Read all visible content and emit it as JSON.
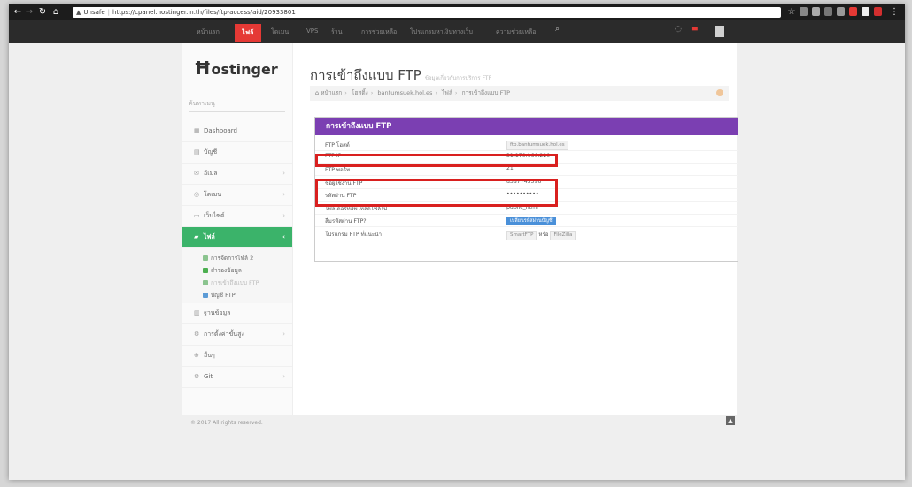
{
  "browser": {
    "url_label": "Unsafe",
    "url": "https://cpanel.hostinger.in.th/files/ftp-access/aid/20933801"
  },
  "topnav": {
    "items": [
      "หน้าแรก",
      "ไฟล์",
      "โดเมน",
      "VPS",
      "ร้าน",
      "การช่วยเหลือ",
      "โปรแกรมหาเงินทางเว็บ",
      "ความช่วยเหลือ"
    ],
    "active": "ไฟล์"
  },
  "sidebar": {
    "logo": "ostinger",
    "search_placeholder": "ค้นหาเมนู",
    "menu": [
      {
        "label": "Dashboard",
        "icon": "dashboard-icon"
      },
      {
        "label": "บัญชี",
        "icon": "user-icon"
      },
      {
        "label": "อีเมล",
        "icon": "mail-icon"
      },
      {
        "label": "โดเมน",
        "icon": "globe-icon"
      },
      {
        "label": "เว็บไซต์",
        "icon": "monitor-icon"
      }
    ],
    "active_item": "ไฟล์",
    "sub_items": [
      "การจัดการไฟล์ 2",
      "สำรองข้อมูล",
      "การเข้าถึงแบบ FTP",
      "บัญชี FTP"
    ],
    "after_items": [
      {
        "label": "ฐานข้อมูล",
        "icon": "database-icon"
      },
      {
        "label": "การตั้งค่าขั้นสูง",
        "icon": "gears-icon"
      },
      {
        "label": "อื่นๆ",
        "icon": "plus-icon"
      },
      {
        "label": "Git",
        "icon": "git-icon"
      }
    ]
  },
  "page": {
    "title": "การเข้าถึงแบบ FTP",
    "title_small": "ข้อมูลเกี่ยวกับการบริการ FTP",
    "breadcrumb": [
      "หน้าแรก",
      "โฮสติ้ง",
      "bantumsuek.hol.es",
      "ไฟล์",
      "การเข้าถึงแบบ FTP"
    ],
    "panel_title": "การเข้าถึงแบบ FTP",
    "rows": [
      {
        "label": "FTP โฮสต์",
        "value": "ftp.bantumsuek.hol.es"
      },
      {
        "label": "FTP IP",
        "value": "31.170.166.220"
      },
      {
        "label": "FTP พอร์ท",
        "value": "21"
      },
      {
        "label": "ชื่อผู้ใช้งาน FTP",
        "value": "u387745596"
      },
      {
        "label": "รหัสผ่าน FTP",
        "value": "••••••••••"
      },
      {
        "label": "โฟลเดอร์ที่อัพโหลดไฟล์ไป",
        "value": "public_html"
      },
      {
        "label": "ลืมรหัสผ่าน FTP?",
        "value": "เปลี่ยนรหัสผ่านบัญชี"
      },
      {
        "label": "โปรแกรม FTP ที่แนะนำ",
        "value": "SmartFTP",
        "or": "หรือ",
        "value2": "FileZilla"
      }
    ]
  },
  "footer": {
    "copyright": "© 2017 All rights reserved."
  }
}
